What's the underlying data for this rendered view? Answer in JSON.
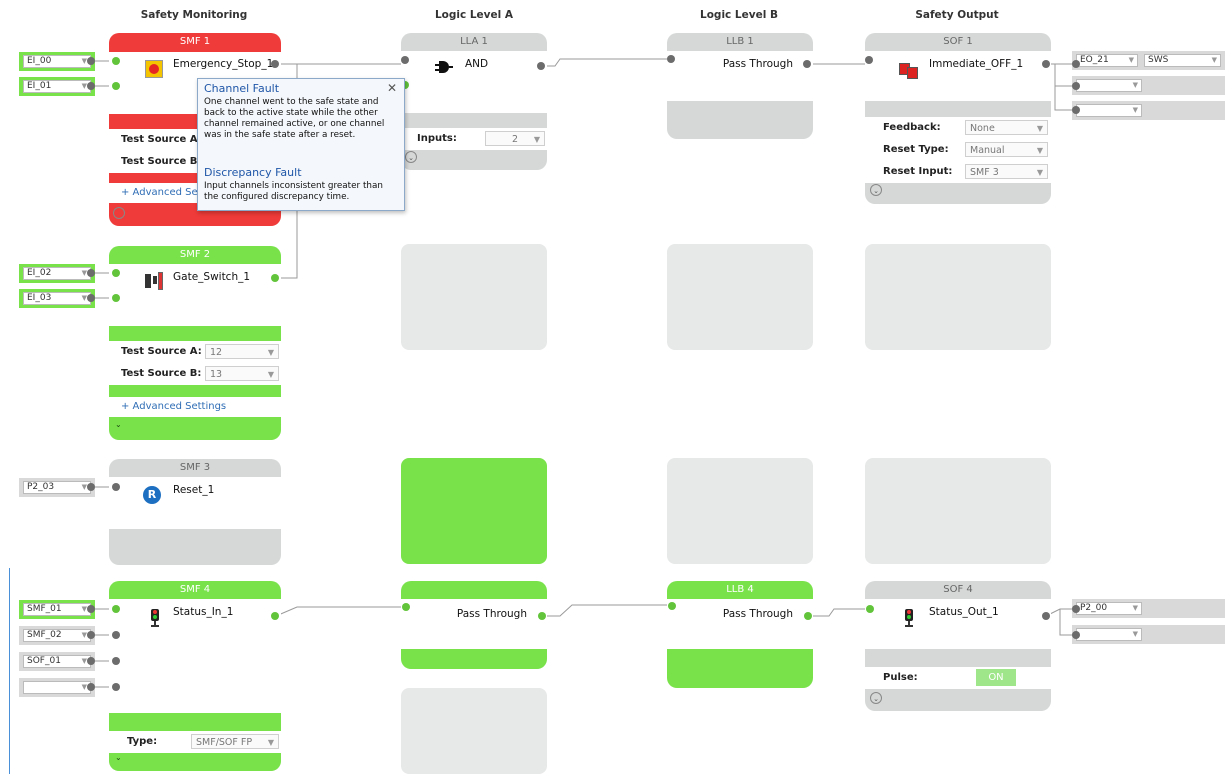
{
  "columns": {
    "safety_monitoring": "Safety Monitoring",
    "logic_a": "Logic Level A",
    "logic_b": "Logic Level B",
    "safety_output": "Safety Output"
  },
  "smf1": {
    "title": "SMF 1",
    "name": "Emergency_Stop_1",
    "test_source_a_label": "Test Source A:",
    "test_source_b_label": "Test Source B:",
    "advanced": "+ Advanced Settings",
    "inputs": [
      "EI_00",
      "EI_01"
    ]
  },
  "smf2": {
    "title": "SMF 2",
    "name": "Gate_Switch_1",
    "test_source_a_label": "Test Source A:",
    "test_source_a_value": "12",
    "test_source_b_label": "Test Source B:",
    "test_source_b_value": "13",
    "advanced": "+ Advanced Settings",
    "inputs": [
      "EI_02",
      "EI_03"
    ]
  },
  "smf3": {
    "title": "SMF 3",
    "name": "Reset_1",
    "inputs": [
      "P2_03"
    ]
  },
  "smf4": {
    "title": "SMF 4",
    "name": "Status_In_1",
    "type_label": "Type:",
    "type_value": "SMF/SOF FP",
    "inputs": [
      "SMF_01",
      "SMF_02",
      "SOF_01",
      ""
    ]
  },
  "lla1": {
    "title": "LLA 1",
    "name": "AND",
    "inputs_label": "Inputs:",
    "inputs_value": "2"
  },
  "lla4": {
    "name": "Pass Through"
  },
  "llb1": {
    "title": "LLB 1",
    "name": "Pass Through"
  },
  "llb4": {
    "title": "LLB 4",
    "name": "Pass Through"
  },
  "sof1": {
    "title": "SOF 1",
    "name": "Immediate_OFF_1",
    "feedback_label": "Feedback:",
    "feedback_value": "None",
    "reset_type_label": "Reset Type:",
    "reset_type_value": "Manual",
    "reset_input_label": "Reset Input:",
    "reset_input_value": "SMF 3",
    "outputs": [
      "EO_21",
      "",
      ""
    ],
    "output_mode": "SWS"
  },
  "sof4": {
    "title": "SOF 4",
    "name": "Status_Out_1",
    "pulse_label": "Pulse:",
    "pulse_value": "ON",
    "outputs": [
      "P2_00",
      ""
    ]
  },
  "tooltip": {
    "heading1": "Channel Fault",
    "text1": "One channel went to the safe state and back to the active state while the other channel remained active, or one channel was in the safe state after a reset.",
    "heading2": "Discrepancy Fault",
    "text2": "Input channels inconsistent greater than the configured discrepancy time.",
    "close": "✕"
  },
  "colors": {
    "fault_red": "#ef3b39",
    "active_green": "#79e24b",
    "idle_grey": "#d6d8d8",
    "link_blue": "#2f6db5"
  }
}
